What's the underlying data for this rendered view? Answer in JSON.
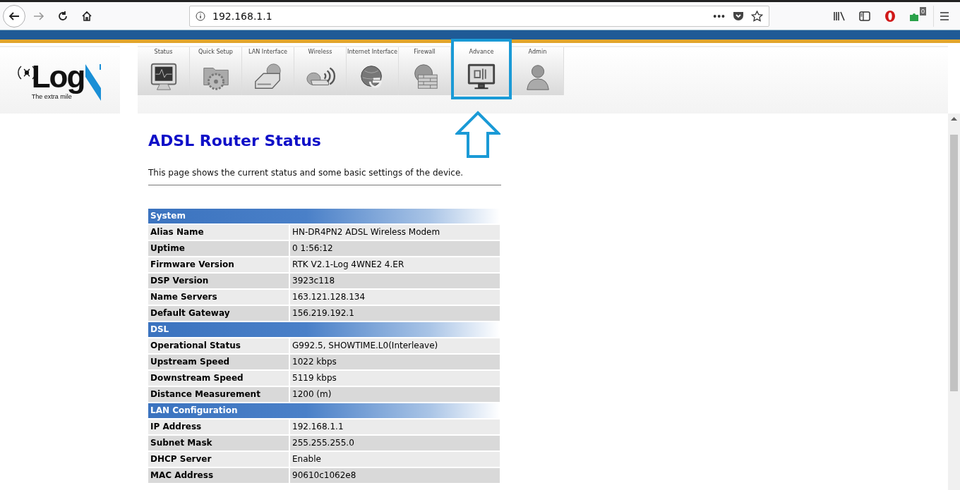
{
  "browser": {
    "url": "192.168.1.1",
    "page_actions": "•••",
    "extension_badge": "0"
  },
  "header": {
    "logo": {
      "word": "Log",
      "tagline": "The extra mile"
    },
    "tabs": [
      {
        "label": "Status",
        "highlighted": false
      },
      {
        "label": "Quick Setup",
        "highlighted": false
      },
      {
        "label": "LAN Interface",
        "highlighted": false
      },
      {
        "label": "Wireless",
        "highlighted": false
      },
      {
        "label": "Internet Interface",
        "highlighted": false
      },
      {
        "label": "Firewall",
        "highlighted": false
      },
      {
        "label": "Advance",
        "highlighted": true
      },
      {
        "label": "Admin",
        "highlighted": false
      }
    ]
  },
  "page": {
    "title": "ADSL Router Status",
    "description": "This page shows the current status and some basic settings of the device.",
    "sections": [
      {
        "title": "System",
        "rows": [
          {
            "label": "Alias Name",
            "value": "HN-DR4PN2 ADSL Wireless Modem"
          },
          {
            "label": "Uptime",
            "value": "0 1:56:12"
          },
          {
            "label": "Firmware Version",
            "value": "RTK V2.1-Log 4WNE2 4.ER"
          },
          {
            "label": "DSP Version",
            "value": "3923c118"
          },
          {
            "label": "Name Servers",
            "value": "163.121.128.134"
          },
          {
            "label": "Default Gateway",
            "value": "156.219.192.1"
          }
        ]
      },
      {
        "title": "DSL",
        "rows": [
          {
            "label": "Operational Status",
            "value": "G992.5, SHOWTIME.L0(Interleave)"
          },
          {
            "label": "Upstream Speed",
            "value": "1022 kbps"
          },
          {
            "label": "Downstream Speed",
            "value": "5119 kbps"
          },
          {
            "label": "Distance Measurement",
            "value": "1200 (m)"
          }
        ]
      },
      {
        "title": "LAN Configuration",
        "rows": [
          {
            "label": "IP Address",
            "value": "192.168.1.1"
          },
          {
            "label": "Subnet Mask",
            "value": "255.255.255.0"
          },
          {
            "label": "DHCP Server",
            "value": "Enable"
          },
          {
            "label": "MAC Address",
            "value": "90610c1062e8"
          }
        ]
      }
    ]
  }
}
